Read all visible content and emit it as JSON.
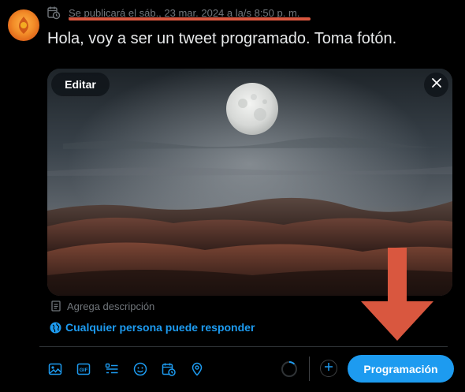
{
  "schedule": {
    "text": "Se publicará el sáb., 23 mar. 2024 a la/s 8:50 p. m.",
    "icon": "calendar-clock-icon"
  },
  "tweet": {
    "text": "Hola, voy a ser un tweet programado. Toma fotón."
  },
  "media": {
    "edit_label": "Editar",
    "close_icon": "close-icon",
    "description": "Agrega descripción"
  },
  "reply_setting": {
    "label": "Cualquier persona puede responder",
    "icon": "globe-icon"
  },
  "toolbar": {
    "icons": [
      "image-icon",
      "gif-icon",
      "poll-icon",
      "emoji-icon",
      "schedule-icon",
      "location-icon"
    ],
    "gif_label": "GIF",
    "submit_label": "Programación"
  },
  "colors": {
    "accent": "#1d9bf0",
    "background": "#000000",
    "muted_text": "#71767b",
    "annotation": "#d9573f"
  }
}
